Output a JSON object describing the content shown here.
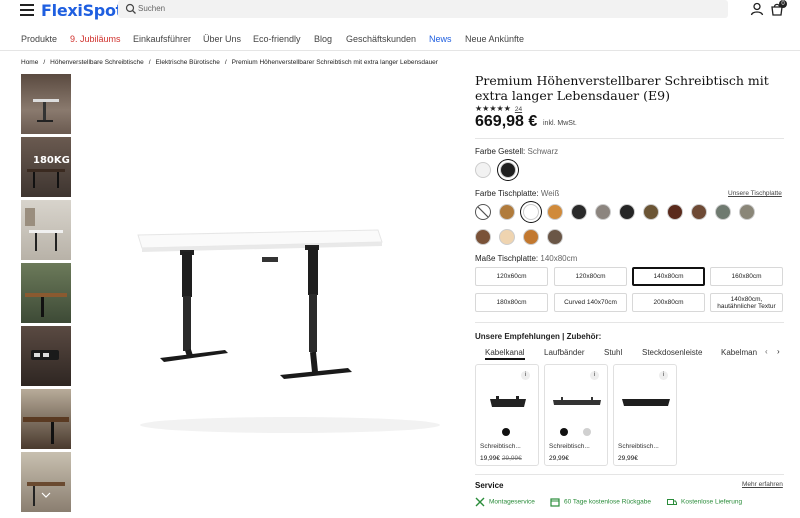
{
  "header": {
    "logo": "FlexiSpot",
    "search_placeholder": "Suchen",
    "cart_count": "0"
  },
  "nav": {
    "items": [
      "Produkte",
      "9. Jubiläums",
      "Einkaufsführer",
      "Über Uns",
      "Eco-friendly",
      "Blog",
      "Geschäftskunden",
      "News",
      "Neue Ankünfte"
    ]
  },
  "breadcrumb": [
    "Home",
    "Höhenverstellbare Schreibtische",
    "Elektrische Bürotische",
    "Premium Höhenverstellbarer Schreibtisch mit extra langer Lebensdauer"
  ],
  "product": {
    "title": "Premium Höhenverstellbarer Schreibtisch mit extra langer Lebensdauer (E9)",
    "stars": "★★★★★",
    "rating_count": "24",
    "price": "669,98 €",
    "vat": "inkl. MwSt."
  },
  "frame": {
    "label": "Farbe Gestell:",
    "value": "Schwarz",
    "colors": [
      "#f2f2f2",
      "#1f1f1f"
    ],
    "selected_index": 1
  },
  "top": {
    "label": "Farbe Tischplatte:",
    "value": "Weiß",
    "link": "Unsere Tischplatte",
    "colors": [
      "none",
      "#b07b3c",
      "#ffffff",
      "#d08a3a",
      "#2a2a2a",
      "#8c857f",
      "#252525",
      "#6b5535",
      "#5a2a1c",
      "#6e4a35",
      "#6f7a70",
      "#8a8678",
      "#7a5238",
      "#efd4b0",
      "#c2782f",
      "#6a5646"
    ],
    "selected_index": 2
  },
  "size": {
    "label": "Maße Tischplatte:",
    "value": "140x80cm",
    "options": [
      "120x60cm",
      "120x80cm",
      "140x80cm",
      "160x80cm",
      "180x80cm",
      "Curved 140x70cm",
      "200x80cm",
      "140x80cm, hautähnlicher Textur"
    ],
    "selected_index": 2
  },
  "recommendations": {
    "heading": "Unsere Empfehlungen | Zubehör:",
    "tabs": [
      "Kabelkanal",
      "Laufbänder",
      "Stuhl",
      "Steckdosenleiste",
      "Kabelman"
    ],
    "active_tab": 0,
    "cards": [
      {
        "name": "Schreibtisch...",
        "price": "19,99€",
        "old_price": "29,99€"
      },
      {
        "name": "Schreibtisch...",
        "price": "29,99€",
        "old_price": ""
      },
      {
        "name": "Schreibtisch...",
        "price": "29,99€",
        "old_price": ""
      }
    ]
  },
  "service": {
    "heading": "Service",
    "more": "Mehr erfahren",
    "items": [
      "Montageservice",
      "60 Tage kostenlose Rückgabe",
      "Kostenlose Lieferung"
    ]
  },
  "thumbnail_labels": [
    "",
    "180KG",
    "",
    "",
    "",
    "",
    ""
  ]
}
